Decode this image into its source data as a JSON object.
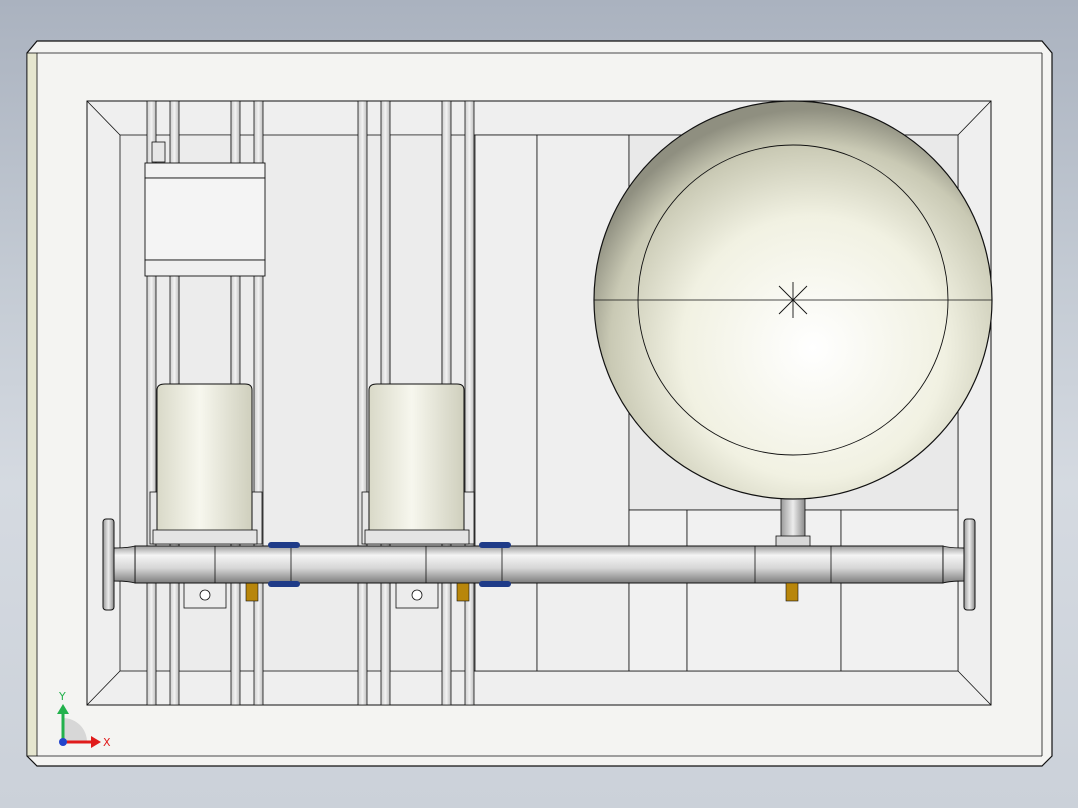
{
  "view": {
    "background_top": "#aab2bf",
    "background_bottom": "#d5dae1"
  },
  "model": {
    "frame_color": "#f4f4f2",
    "frame_edge_color": "#e6e6cf",
    "panel_color": "#ececec",
    "tank_color": "#f3f3e6",
    "pipe_color": "#e2e2e2",
    "outline_color": "#111111",
    "valve_color": "#1f3b88",
    "fitting_color": "#b8860b"
  },
  "triad": {
    "y_label": "Y",
    "x_label": "X",
    "y_color": "#22b14c",
    "x_color": "#e01b1b",
    "z_color": "#2244cc"
  }
}
